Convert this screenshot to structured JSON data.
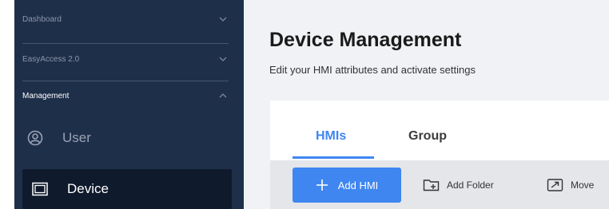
{
  "sidebar": {
    "groups": [
      {
        "label": "Dashboard",
        "icon": "chevron-down-icon"
      },
      {
        "label": "EasyAccess 2.0",
        "icon": "chevron-down-icon"
      },
      {
        "label": "Management",
        "icon": "chevron-up-icon"
      }
    ],
    "items": [
      {
        "label": "User",
        "icon": "user-circle-icon",
        "active": false
      },
      {
        "label": "Device",
        "icon": "device-screen-icon",
        "active": true
      }
    ]
  },
  "main": {
    "title": "Device Management",
    "subtitle": "Edit your HMI attributes and activate settings",
    "tabs": [
      {
        "label": "HMIs",
        "active": true
      },
      {
        "label": "Group",
        "active": false
      }
    ],
    "toolbar": {
      "add_hmi": "Add HMI",
      "add_folder": "Add Folder",
      "move": "Move"
    }
  },
  "colors": {
    "sidebar_bg": "#1e2f4a",
    "sidebar_active_bg": "#0f1a2c",
    "accent": "#3f86f0",
    "toolbar_bg": "#e4e6ea",
    "page_bg": "#f0f2f5"
  }
}
